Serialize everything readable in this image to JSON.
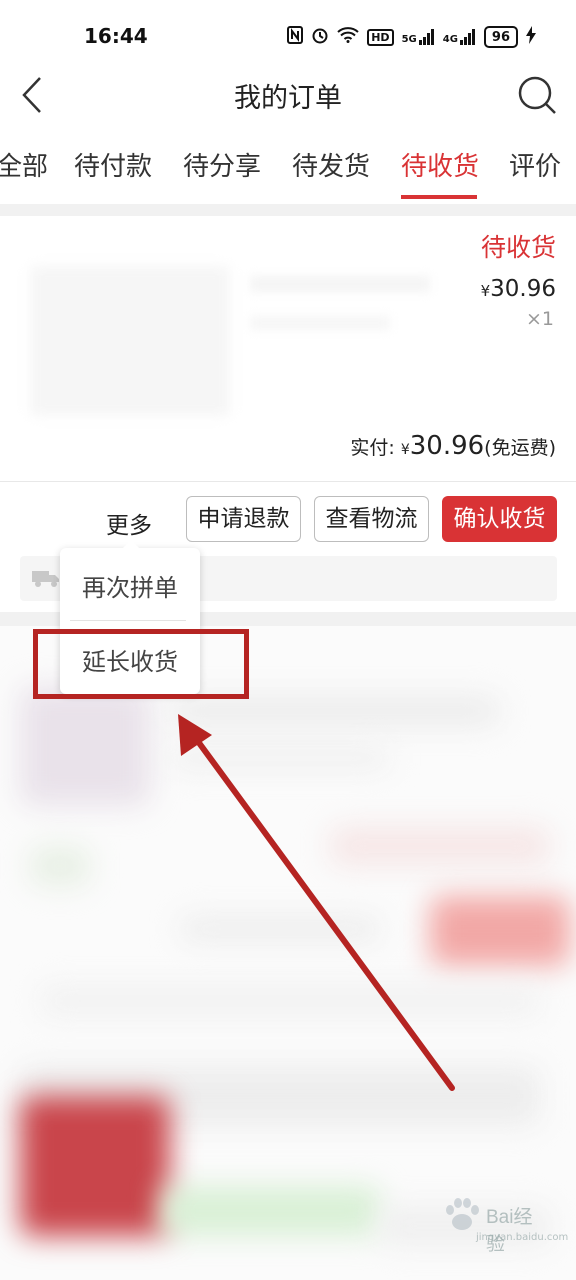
{
  "status_bar": {
    "time": "16:44",
    "icons": [
      "nfc-icon",
      "alarm-icon",
      "wifi-icon",
      "hd-icon",
      "signal-5g-icon",
      "signal-4g-icon"
    ],
    "hd_label": "HD",
    "sig1_label": "5G",
    "sig2_label": "4G",
    "battery": "96"
  },
  "header": {
    "title": "我的订单"
  },
  "tabs": [
    {
      "label": "全部"
    },
    {
      "label": "待付款"
    },
    {
      "label": "待分享"
    },
    {
      "label": "待发货"
    },
    {
      "label": "待收货",
      "active": true
    },
    {
      "label": "评价"
    }
  ],
  "order": {
    "status": "待收货",
    "currency": "¥",
    "price": "30.96",
    "qty": "×1",
    "paid_label": "实付:",
    "paid_amount": "30.96",
    "shipping_note": "(免运费)",
    "buttons": {
      "more": "更多",
      "refund": "申请退款",
      "track": "查看物流",
      "confirm": "确认收货"
    }
  },
  "popup": {
    "items": [
      "再次拼单",
      "延长收货"
    ]
  },
  "watermark": {
    "brand": "Bai",
    "text": "经验",
    "url": "jingyan.baidu.com"
  },
  "colors": {
    "accent": "#d93335",
    "annotation": "#b52422"
  }
}
